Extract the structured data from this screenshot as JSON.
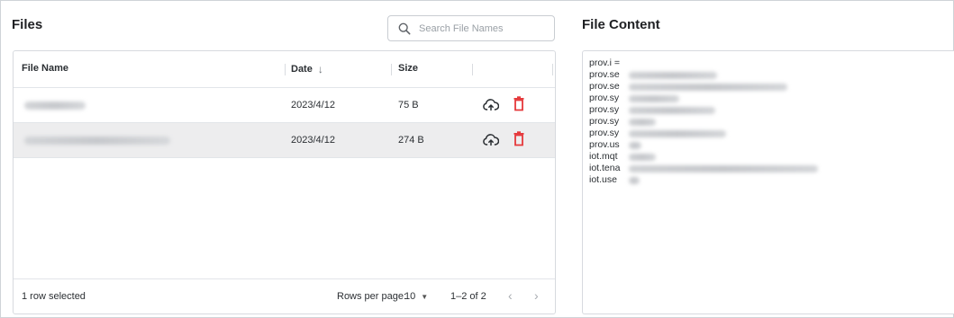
{
  "files_panel": {
    "title": "Files",
    "search": {
      "placeholder": "Search File Names",
      "value": ""
    },
    "columns": {
      "file_name": "File Name",
      "date": "Date",
      "date_sort": "↓",
      "size": "Size"
    },
    "rows": [
      {
        "name_blurred": true,
        "date": "2023/4/12",
        "size": "75 B",
        "selected": false
      },
      {
        "name_blurred": true,
        "date": "2023/4/12",
        "size": "274 B",
        "selected": true
      }
    ],
    "footer": {
      "selection": "1 row selected",
      "rows_per_page_label": "Rows per page:",
      "rows_per_page_value": "10",
      "range": "1–2 of 2"
    }
  },
  "content_panel": {
    "title": "File Content",
    "lines": [
      "prov.i =",
      "prov.se",
      "prov.se",
      "prov.sy",
      "prov.sy",
      "prov.sy",
      "prov.sy",
      "prov.us",
      "iot.mqt",
      "iot.tena",
      "iot.use"
    ]
  },
  "colors": {
    "delete": "#e5383b",
    "icon_dark": "#2b2f33",
    "selected_row": "#ededee"
  },
  "icons": [
    "search-icon",
    "cloud-upload-icon",
    "trash-icon",
    "sort-down-icon",
    "chevron-left-icon",
    "chevron-right-icon",
    "caret-down-icon"
  ]
}
